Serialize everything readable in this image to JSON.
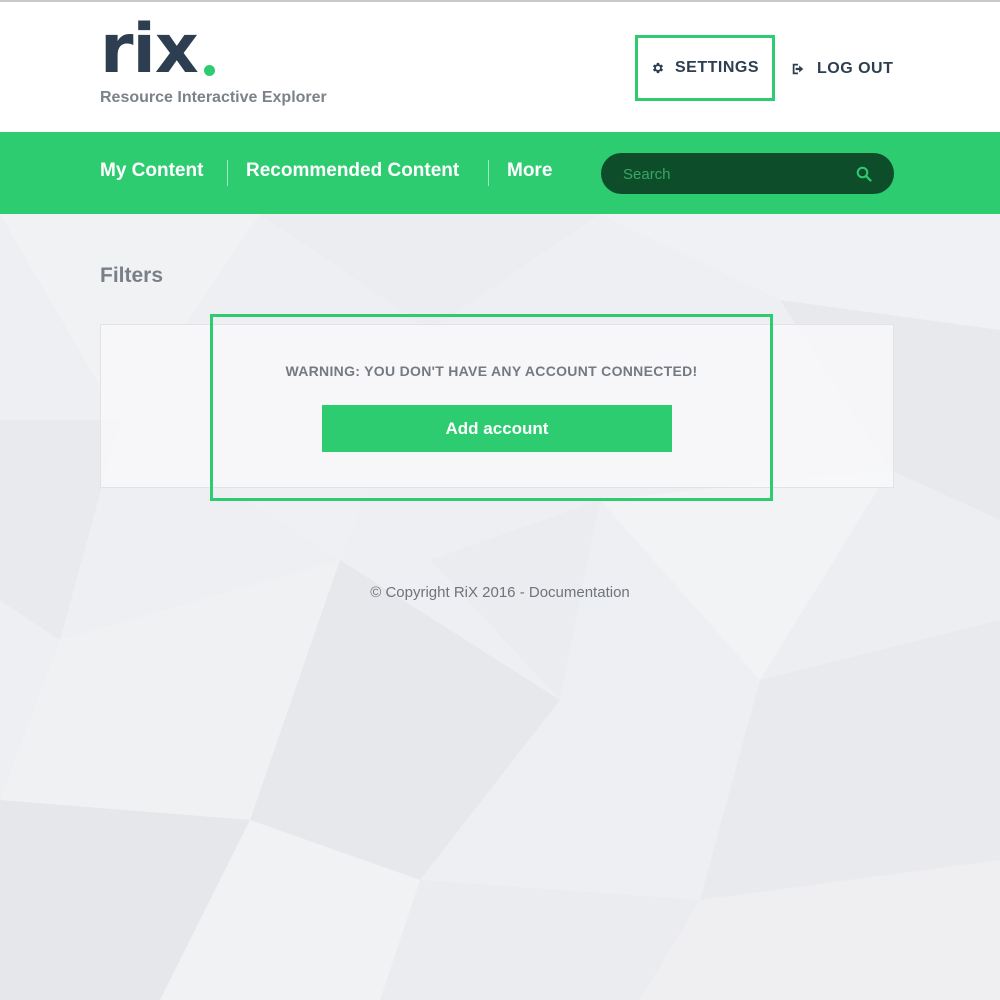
{
  "brand": {
    "logo_text": "rix",
    "tagline": "Resource Interactive Explorer",
    "accent_color": "#2ecc71",
    "dark_color": "#2c3e50"
  },
  "header": {
    "settings": {
      "label": "SETTINGS",
      "icon": "gear-icon"
    },
    "logout": {
      "label": "LOG OUT",
      "icon": "sign-out-icon"
    }
  },
  "nav": {
    "items": [
      {
        "label": "My Content"
      },
      {
        "label": "Recommended Content"
      },
      {
        "label": "More"
      }
    ],
    "search": {
      "placeholder": "Search",
      "value": "",
      "icon": "search-icon"
    }
  },
  "main": {
    "filters_heading": "Filters",
    "warning_text": "WARNING: YOU DON'T HAVE ANY ACCOUNT CONNECTED!",
    "add_account_label": "Add account"
  },
  "footer": {
    "copyright": "© Copyright RiX 2016 - ",
    "documentation_link": "Documentation"
  }
}
